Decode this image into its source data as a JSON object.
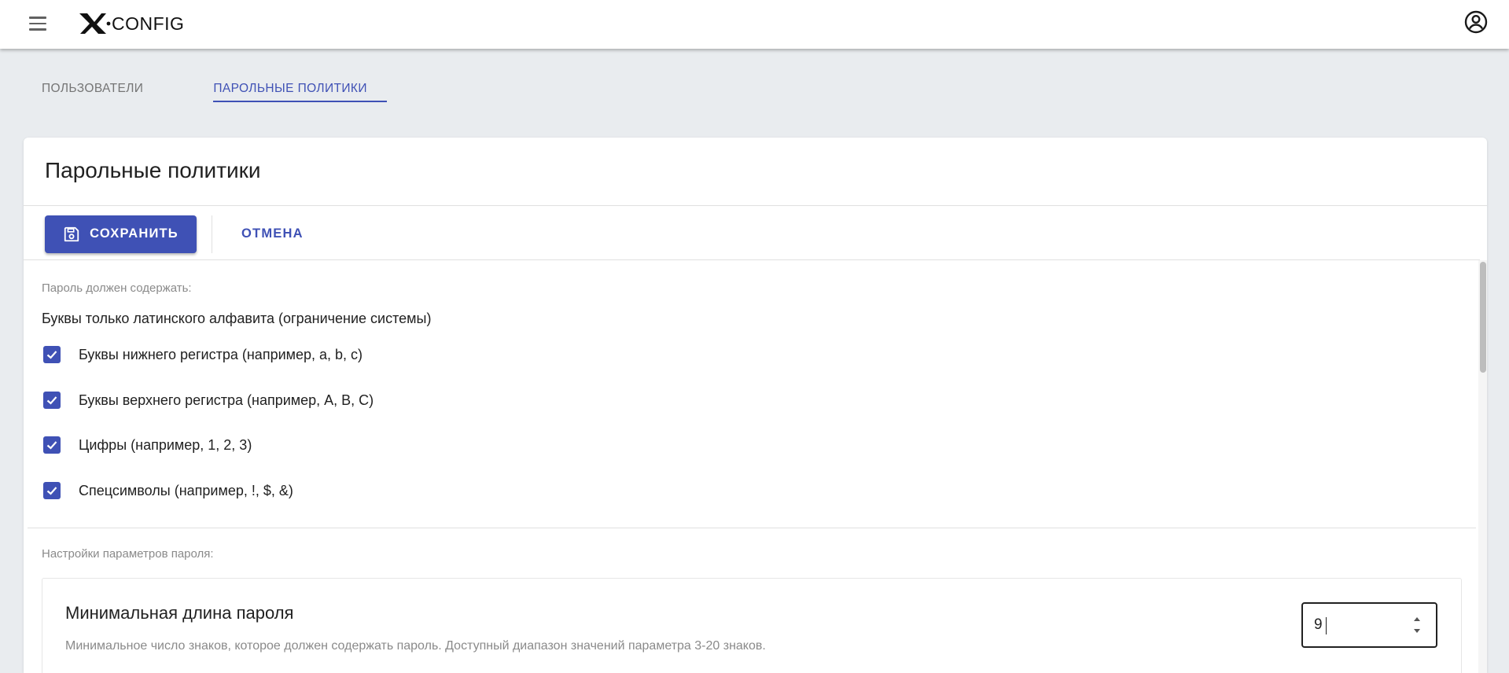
{
  "appbar": {
    "logo_text": "CONFIG",
    "icons": {
      "menu": "menu-icon",
      "account": "account-circle-icon",
      "logo": "x-logo-icon"
    }
  },
  "tabs": [
    {
      "label": "ПОЛЬЗОВАТЕЛИ",
      "active": false
    },
    {
      "label": "ПАРОЛЬНЫЕ ПОЛИТИКИ",
      "active": true
    }
  ],
  "card": {
    "title": "Парольные политики",
    "toolbar": {
      "save_label": "СОХРАНИТЬ",
      "save_icon": "save-icon",
      "cancel_label": "ОТМЕНА"
    },
    "must_contain_label": "Пароль должен содержать:",
    "latin_note": "Буквы только латинского алфавита (ограничение системы)",
    "checks": [
      {
        "label": "Буквы нижнего регистра (например, a, b, c)",
        "checked": true
      },
      {
        "label": "Буквы верхнего регистра (например, A, B, C)",
        "checked": true
      },
      {
        "label": "Цифры (например, 1, 2, 3)",
        "checked": true
      },
      {
        "label": "Спецсимволы (например, !, $, &)",
        "checked": true
      }
    ],
    "params_label": "Настройки параметров пароля:",
    "min_length": {
      "title": "Минимальная длина пароля",
      "description": "Минимальное число знаков, которое должен содержать пароль. Доступный диапазон значений параметра 3-20 знаков.",
      "value": "9"
    }
  },
  "colors": {
    "primary": "#3f51b5",
    "background": "#e9ecef",
    "muted_text": "#8a8a8a"
  }
}
